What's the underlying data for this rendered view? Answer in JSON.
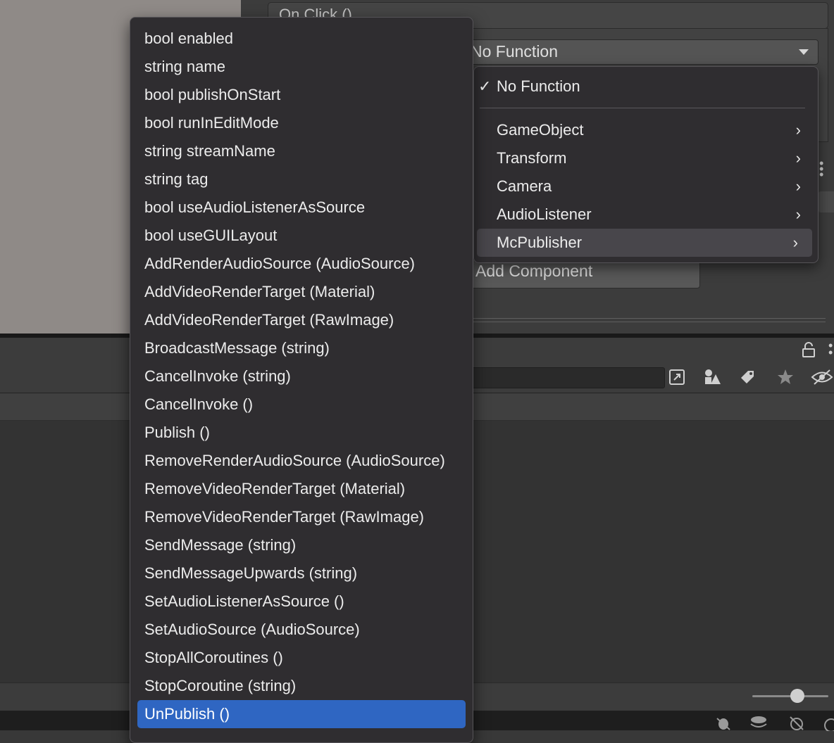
{
  "inspector": {
    "event_header": "On Click ()",
    "function_dropdown_value": "No Function",
    "add_component_label": "Add Component"
  },
  "function_submenu": {
    "items": [
      {
        "label": "No Function",
        "checked": true,
        "has_submenu": false
      },
      {
        "label": "GameObject",
        "has_submenu": true
      },
      {
        "label": "Transform",
        "has_submenu": true
      },
      {
        "label": "Camera",
        "has_submenu": true
      },
      {
        "label": "AudioListener",
        "has_submenu": true
      },
      {
        "label": "McPublisher",
        "has_submenu": true,
        "highlighted": true
      }
    ],
    "check_glyph": "✓",
    "chevron_glyph": "›"
  },
  "member_menu": {
    "items": [
      "bool enabled",
      "string name",
      "bool publishOnStart",
      "bool runInEditMode",
      "string streamName",
      "string tag",
      "bool useAudioListenerAsSource",
      "bool useGUILayout",
      "AddRenderAudioSource (AudioSource)",
      "AddVideoRenderTarget (Material)",
      "AddVideoRenderTarget (RawImage)",
      "BroadcastMessage (string)",
      "CancelInvoke (string)",
      "CancelInvoke ()",
      "Publish ()",
      "RemoveRenderAudioSource (AudioSource)",
      "RemoveVideoRenderTarget (Material)",
      "RemoveVideoRenderTarget (RawImage)",
      "SendMessage (string)",
      "SendMessageUpwards (string)",
      "SetAudioListenerAsSource ()",
      "SetAudioSource (AudioSource)",
      "StopAllCoroutines ()",
      "StopCoroutine (string)",
      "UnPublish ()"
    ],
    "selected": "UnPublish ()"
  },
  "colors": {
    "menu_bg": "#2f2d30",
    "selection": "#2f66c2",
    "hover": "#48464b"
  },
  "icons": [
    "lock-icon",
    "kebab-icon",
    "view-icon",
    "shapes-icon",
    "tag-icon",
    "star-icon",
    "hidden-eye-icon",
    "debug-icon",
    "layers-icon",
    "network-icon",
    "check-circle-icon"
  ]
}
